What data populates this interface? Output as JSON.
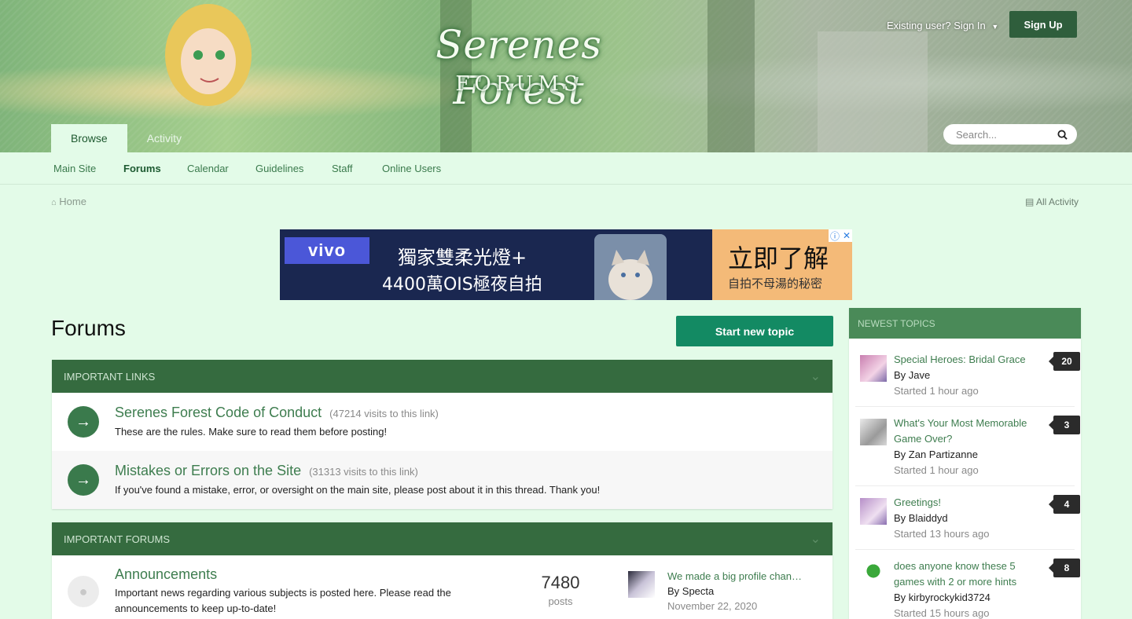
{
  "header": {
    "logo_title": "Serenes Forest",
    "logo_sub": "FORUMS",
    "signin_label": "Existing user? Sign In",
    "signup_label": "Sign Up",
    "tabs": [
      {
        "label": "Browse"
      },
      {
        "label": "Activity"
      }
    ],
    "search_placeholder": "Search..."
  },
  "subnav": [
    {
      "label": "Main Site"
    },
    {
      "label": "Forums"
    },
    {
      "label": "Calendar"
    },
    {
      "label": "Guidelines"
    },
    {
      "label": "Staff"
    },
    {
      "label": "Online Users"
    }
  ],
  "breadcrumb": {
    "home_label": "Home",
    "all_activity_label": "All Activity"
  },
  "ad": {
    "brand": "vivo",
    "line1": "獨家雙柔光燈+",
    "line2": "4400萬OIS極夜自拍",
    "cta": "立即了解",
    "cta_sub": "自拍不母湯的秘密"
  },
  "page": {
    "title": "Forums",
    "start_topic_label": "Start new topic"
  },
  "important_links": {
    "header": "IMPORTANT LINKS",
    "items": [
      {
        "title": "Serenes Forest Code of Conduct",
        "visits": "(47214 visits to this link)",
        "desc": "These are the rules. Make sure to read them before posting!"
      },
      {
        "title": "Mistakes or Errors on the Site",
        "visits": "(31313 visits to this link)",
        "desc": "If you've found a mistake, error, or oversight on the main site, please post about it in this thread. Thank you!"
      }
    ]
  },
  "important_forums": {
    "header": "IMPORTANT FORUMS",
    "items": [
      {
        "title": "Announcements",
        "desc": "Important news regarding various subjects is posted here. Please read the announcements to keep up-to-date!",
        "count": "7480",
        "count_label": "posts",
        "last_title": "We made a big profile chan…",
        "last_by": "By Specta",
        "last_date": "November 22, 2020"
      }
    ]
  },
  "sidebar": {
    "header": "NEWEST TOPICS",
    "topics": [
      {
        "title": "Special Heroes: Bridal Grace",
        "by": "By Jave",
        "time": "Started 1 hour ago",
        "count": "20"
      },
      {
        "title": "What's Your Most Memorable Game Over?",
        "by": "By Zan Partizanne",
        "time": "Started 1 hour ago",
        "count": "3"
      },
      {
        "title": "Greetings!",
        "by": "By Blaiddyd",
        "time": "Started 13 hours ago",
        "count": "4"
      },
      {
        "title": "does anyone know these 5 games with 2 or more hints",
        "by": "By kirbyrockykid3724",
        "time": "Started 15 hours ago",
        "count": "8"
      }
    ]
  },
  "colors": {
    "accent": "#356b3f",
    "link": "#3e7d4f",
    "button": "#138a63",
    "background": "#e3fbe8"
  }
}
